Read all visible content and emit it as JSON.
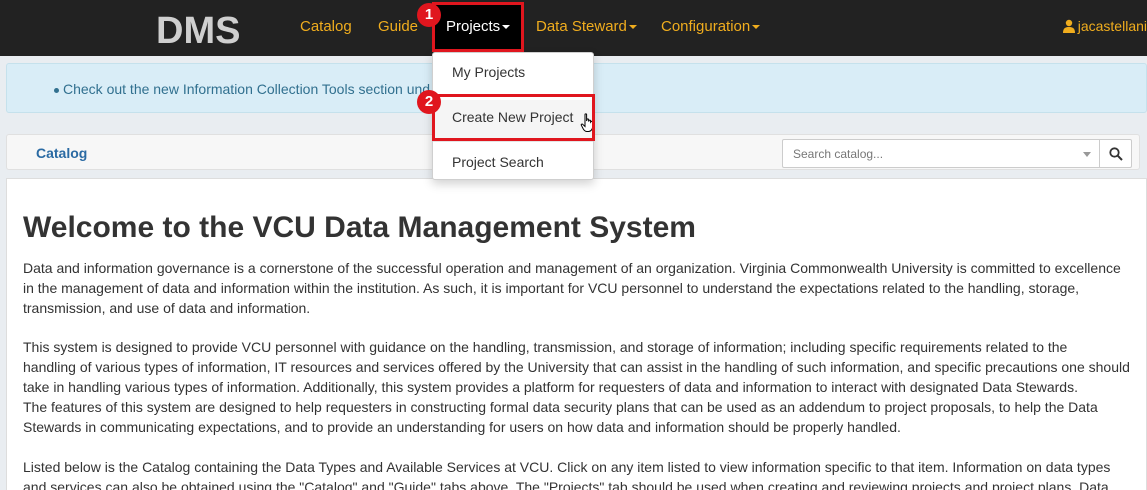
{
  "navbar": {
    "brand": "DMS",
    "items": [
      {
        "label": "Catalog",
        "has_caret": false
      },
      {
        "label": "Guide",
        "has_caret": false
      },
      {
        "label": "Projects",
        "has_caret": true,
        "active": true
      },
      {
        "label": "Data Steward",
        "has_caret": true
      },
      {
        "label": "Configuration",
        "has_caret": true
      }
    ],
    "user": {
      "icon": "user-icon",
      "name": "jacastellani"
    }
  },
  "dropdown": {
    "items": [
      {
        "label": "My Projects"
      },
      {
        "label": "Create New Project",
        "hovered": true
      },
      {
        "label": "Project Search"
      }
    ]
  },
  "annotations": {
    "badge1": "1",
    "badge2": "2",
    "color": "#e0161e"
  },
  "alert": {
    "text": "Check out the new Information Collection Tools section und"
  },
  "catalog_bar": {
    "title": "Catalog",
    "search_placeholder": "Search catalog...",
    "search_icon": "search-icon"
  },
  "main": {
    "heading": "Welcome to the VCU Data Management System",
    "para1": [
      "Data and information governance is a cornerstone of the successful operation and management of an organization. Virginia Commonwealth University is committed to excellence",
      "in the management of data and information within the institution. As such, it is important for VCU personnel to understand the expectations related to the handling, storage,",
      "transmission, and use of data and information."
    ],
    "para2": [
      "This system is designed to provide VCU personnel with guidance on the handling, transmission, and storage of information; including specific requirements related to the",
      "handling of various types of information, IT resources and services offered by the University that can assist in the handling of such information, and specific precautions one should",
      "take in handling various types of information. Additionally, this system provides a platform for requesters of data and information to interact with designated Data Stewards.",
      "The features of this system are designed to help requesters in constructing formal data security plans that can be used as an addendum to project proposals, to help the Data",
      "Stewards in communicating expectations, and to provide an understanding for users on how data and information should be properly handled."
    ],
    "para3": [
      "Listed below is the Catalog containing the Data Types and Available Services at VCU.  Click on any item listed to view information specific to that item. Information on data types",
      "and services can also be obtained using the \"Catalog\" and \"Guide\" tabs above.  The \"Projects\" tab should be used when creating and reviewing projects and project plans.  Data"
    ]
  },
  "colors": {
    "navbar_bg": "#222222",
    "nav_link": "#f0ad1e",
    "alert_bg": "#d9edf7",
    "alert_text": "#31708f",
    "catalog_title": "#2a6aa3"
  }
}
